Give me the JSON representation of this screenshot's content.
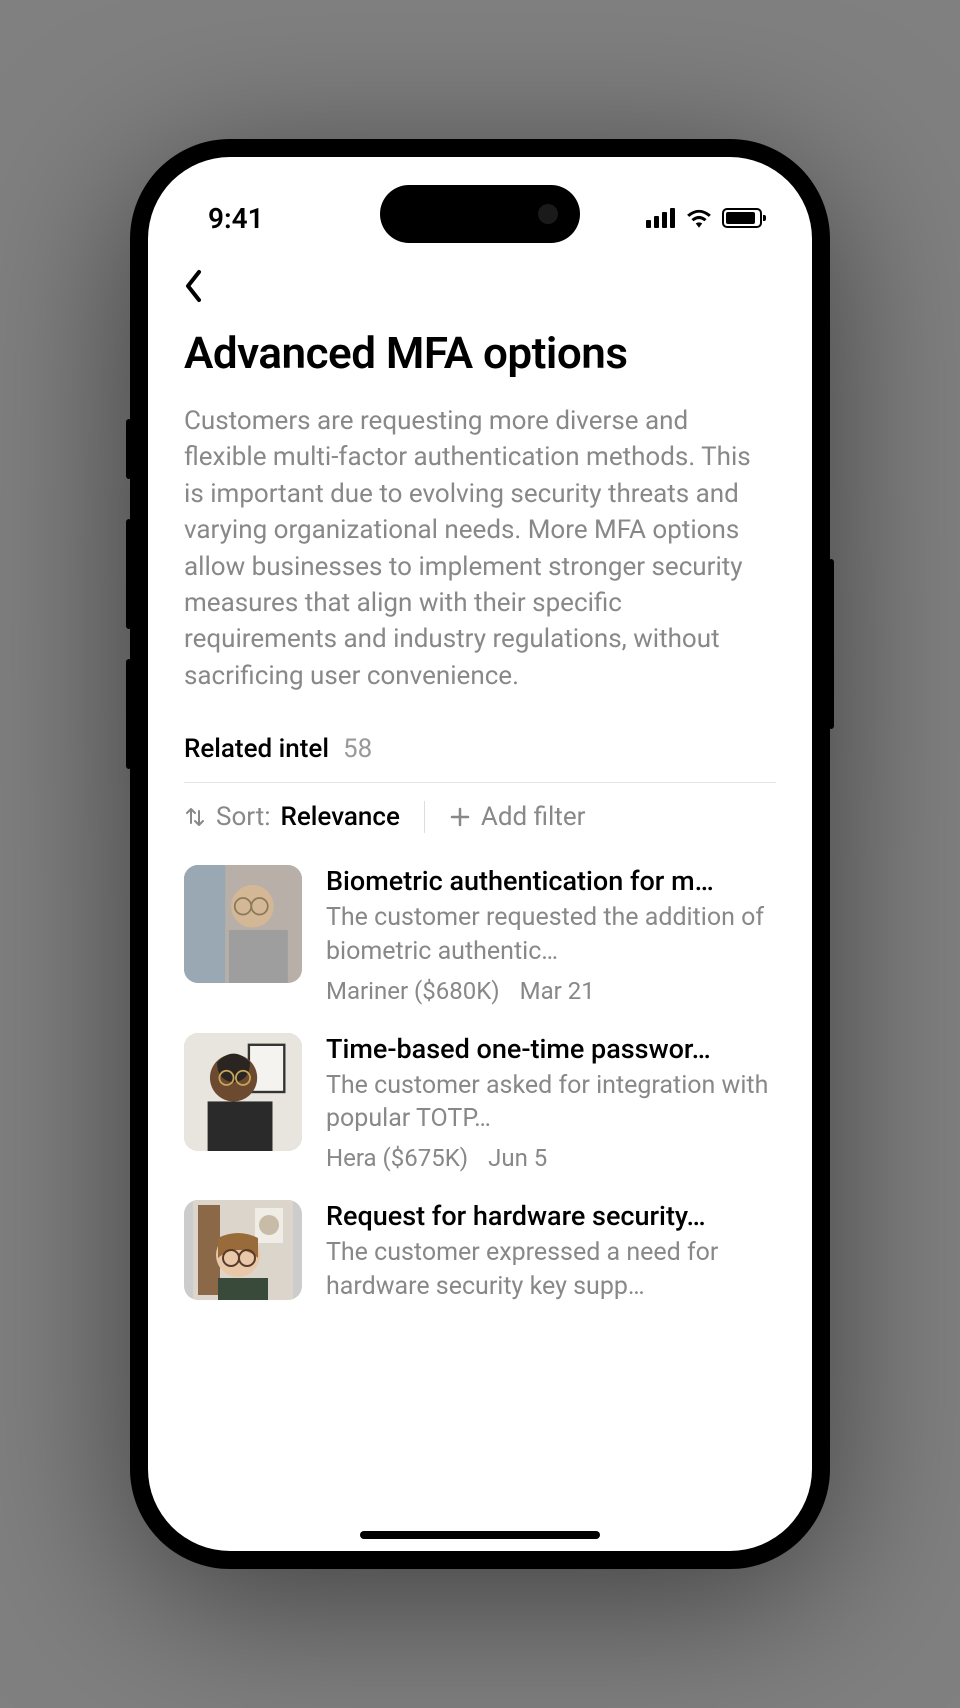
{
  "status": {
    "time": "9:41"
  },
  "page": {
    "title": "Advanced MFA options",
    "description": "Customers are requesting more diverse and flexible multi-factor authentication methods. This is important due to evolving security threats and varying organizational needs. More MFA options allow businesses to implement stronger security measures that align with their specific requirements and industry regulations, without sacrificing user convenience."
  },
  "related": {
    "label": "Related intel",
    "count": "58"
  },
  "controls": {
    "sort_label": "Sort:",
    "sort_value": "Relevance",
    "add_filter": "Add filter"
  },
  "items": [
    {
      "title": "Biometric authentication for m…",
      "snippet": "The customer requested the addition of biometric authentic…",
      "account": "Mariner ($680K)",
      "date": "Mar 21"
    },
    {
      "title": "Time-based one-time passwor…",
      "snippet": "The customer asked for integration with popular TOTP…",
      "account": "Hera ($675K)",
      "date": "Jun 5"
    },
    {
      "title": "Request for hardware security…",
      "snippet": "The customer expressed a need for hardware security key supp…",
      "account": "",
      "date": ""
    }
  ]
}
